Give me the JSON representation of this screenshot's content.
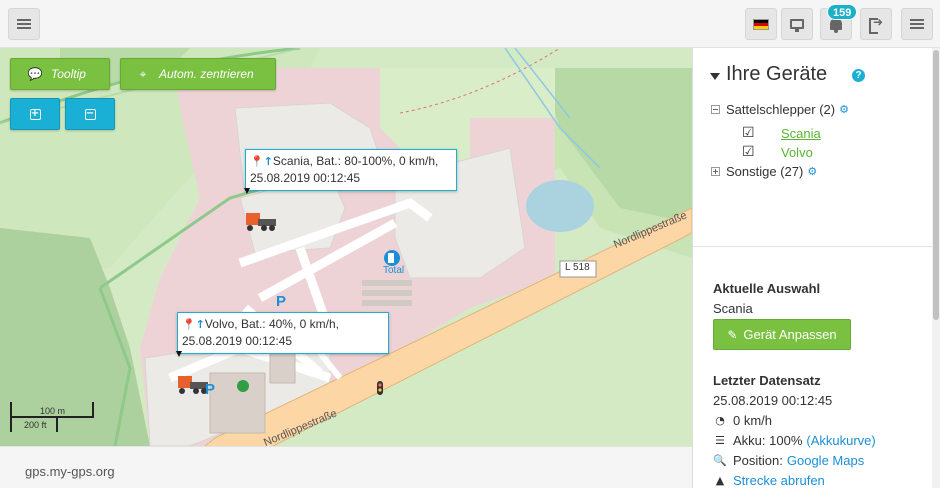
{
  "header": {
    "notification_count": "159",
    "icons": [
      "menu-icon",
      "flag-de-icon",
      "monitor-icon",
      "bell-icon",
      "logout-icon",
      "menu-icon"
    ],
    "flag_colors": [
      "#000000",
      "#dd0000",
      "#ffce00"
    ]
  },
  "map": {
    "tooltip_button": "Tooltip",
    "center_button": "Autom. zentrieren",
    "zoom_in": "+",
    "zoom_out": "−",
    "road_name_1": "Nordlippestraße",
    "road_name_2": "Nordlippestraße",
    "road_ref": "L 518",
    "fuel_brand": "Total",
    "parking": "P",
    "scale_metric": "100 m",
    "scale_imperial": "200 ft",
    "popups": [
      {
        "line1": "Scania, Bat.: 80-100%, 0 km/h,",
        "line2": "25.08.2019 00:12:45"
      },
      {
        "line1": "Volvo, Bat.: 40%, 0 km/h,",
        "line2": "25.08.2019 00:12:45"
      }
    ]
  },
  "footer": {
    "text": "gps.my-gps.org"
  },
  "panel": {
    "title": "Ihre Geräte",
    "groups": [
      {
        "label": "Sattelschlepper (2)",
        "expanded": true,
        "devices": [
          {
            "name": "Scania",
            "checked": true
          },
          {
            "name": "Volvo",
            "checked": true
          }
        ]
      },
      {
        "label": "Sonstige (27)",
        "expanded": false
      }
    ],
    "current": {
      "heading": "Aktuelle Auswahl",
      "device": "Scania",
      "edit_button": "Gerät Anpassen"
    },
    "last_record": {
      "heading": "Letzter Datensatz",
      "timestamp": "25.08.2019 00:12:45",
      "speed": "0 km/h",
      "battery_prefix": "Akku: 100%",
      "battery_link": "(Akkukurve)",
      "position_prefix": "Position:",
      "position_link": "Google Maps",
      "route_link": "Strecke abrufen"
    }
  },
  "colors": {
    "accent_green": "#7ac142",
    "accent_cyan": "#1ab0d6",
    "link_blue": "#1a8fd6",
    "device_green": "#58b531"
  }
}
